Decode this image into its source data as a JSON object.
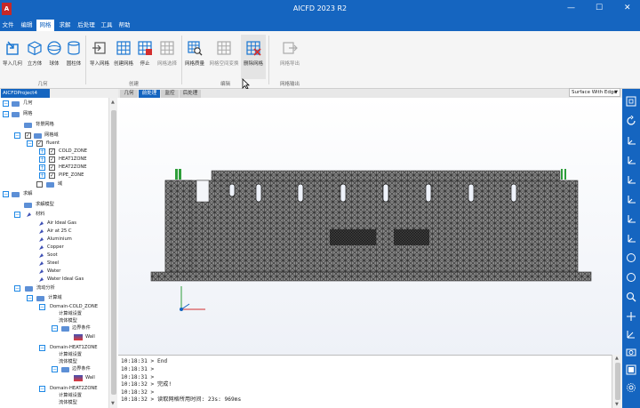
{
  "window": {
    "title": "AICFD 2023 R2",
    "logo": "A"
  },
  "menu": [
    {
      "label": "文件"
    },
    {
      "label": "编辑"
    },
    {
      "label": "网格",
      "active": true
    },
    {
      "label": "求解"
    },
    {
      "label": "后处理"
    },
    {
      "label": "工具"
    },
    {
      "label": "帮助"
    }
  ],
  "ribbon": {
    "groups": [
      {
        "label": "几何"
      },
      {
        "label": "创建"
      },
      {
        "label": "编辑"
      },
      {
        "label": "网格输出"
      }
    ],
    "buttons": [
      {
        "label": "导入几何",
        "icon": "import-geometry-icon"
      },
      {
        "label": "立方体",
        "icon": "cube-icon"
      },
      {
        "label": "球体",
        "icon": "sphere-icon"
      },
      {
        "label": "圆柱体",
        "icon": "cylinder-icon"
      },
      {
        "label": "导入网格",
        "icon": "import-mesh-icon"
      },
      {
        "label": "创建网格",
        "icon": "create-mesh-icon"
      },
      {
        "label": "停止",
        "icon": "stop-icon"
      },
      {
        "label": "网格选择",
        "icon": "mesh-select-icon"
      },
      {
        "label": "网格质量",
        "icon": "mesh-quality-icon"
      },
      {
        "label": "网格空间变换",
        "icon": "mesh-transform-icon"
      },
      {
        "label": "删除网格",
        "icon": "delete-mesh-icon"
      },
      {
        "label": "网格导出",
        "icon": "mesh-export-icon"
      }
    ]
  },
  "project": {
    "tab": "AICFDProject4"
  },
  "tree": {
    "nodes": [
      {
        "label": "几何"
      },
      {
        "label": "网格"
      },
      {
        "label": "背景网格"
      },
      {
        "label": "网格域"
      },
      {
        "label": "fluent"
      },
      {
        "label": "COLD_ZONE"
      },
      {
        "label": "HEAT1ZONE"
      },
      {
        "label": "HEAT2ZONE"
      },
      {
        "label": "PIPE_ZONE"
      },
      {
        "label": "域"
      },
      {
        "label": "求解"
      },
      {
        "label": "求解模型"
      },
      {
        "label": "材料"
      },
      {
        "label": "Air Ideal Gas"
      },
      {
        "label": "Air at 25 C"
      },
      {
        "label": "Aluminium"
      },
      {
        "label": "Copper"
      },
      {
        "label": "Soot"
      },
      {
        "label": "Steel"
      },
      {
        "label": "Water"
      },
      {
        "label": "Water Ideal Gas"
      },
      {
        "label": "流动分析"
      },
      {
        "label": "计算域"
      },
      {
        "label": "Domain-COLD_ZONE"
      },
      {
        "label": "计算域设置"
      },
      {
        "label": "流体模型"
      },
      {
        "label": "边界条件"
      },
      {
        "label": "Wall"
      },
      {
        "label": "Domain-HEAT1ZONE"
      },
      {
        "label": "计算域设置"
      },
      {
        "label": "流体模型"
      },
      {
        "label": "边界条件"
      },
      {
        "label": "Wall"
      },
      {
        "label": "Domain-HEAT2ZONE"
      },
      {
        "label": "计算域设置"
      },
      {
        "label": "流体模型"
      }
    ]
  },
  "view_tabs": [
    {
      "label": "几何"
    },
    {
      "label": "前处理",
      "active": true
    },
    {
      "label": "监控"
    },
    {
      "label": "后处理"
    }
  ],
  "view_mode": {
    "selected": "Surface With Edge"
  },
  "console": {
    "lines": [
      "10:18:31 > End",
      "10:18:31 >",
      "10:18:31 >",
      "10:18:32 > 完成!",
      "10:18:32 >",
      "10:18:32 > 读取网格所用时间: 23s: 969ms"
    ]
  },
  "colors": {
    "accent": "#1565c0",
    "mesh": "#4a4a4a",
    "wall_icon": "#3f51b5"
  }
}
